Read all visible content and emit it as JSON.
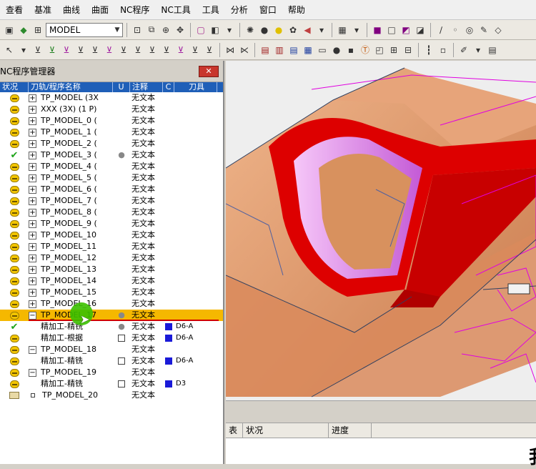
{
  "menu": [
    "查看",
    "基准",
    "曲线",
    "曲面",
    "NC程序",
    "NC工具",
    "工具",
    "分析",
    "窗口",
    "帮助"
  ],
  "toolbar": {
    "model_combo": "MODEL"
  },
  "panel": {
    "title": "NC程序管理器",
    "close_label": "✕",
    "columns": [
      "状况",
      "刀轨/程序名称",
      "U",
      "注释",
      "C",
      "刀具"
    ],
    "rows": [
      {
        "state": "yellow",
        "expand": "+",
        "name": "TP_MODEL (3X",
        "bulb": false,
        "u": false,
        "note": "无文本",
        "c": false,
        "tool": ""
      },
      {
        "state": "yellow",
        "expand": "+",
        "name": "XXX (3X) (1 P)",
        "bulb": false,
        "u": false,
        "note": "无文本",
        "c": false,
        "tool": ""
      },
      {
        "state": "yellow",
        "expand": "+",
        "name": "TP_MODEL_0 (",
        "bulb": false,
        "u": false,
        "note": "无文本",
        "c": false,
        "tool": ""
      },
      {
        "state": "yellow",
        "expand": "+",
        "name": "TP_MODEL_1 (",
        "bulb": false,
        "u": false,
        "note": "无文本",
        "c": false,
        "tool": ""
      },
      {
        "state": "yellow",
        "expand": "+",
        "name": "TP_MODEL_2 (",
        "bulb": false,
        "u": false,
        "note": "无文本",
        "c": false,
        "tool": ""
      },
      {
        "state": "check",
        "expand": "+",
        "name": "TP_MODEL_3 (",
        "bulb": true,
        "u": false,
        "note": "无文本",
        "c": false,
        "tool": ""
      },
      {
        "state": "yellow",
        "expand": "+",
        "name": "TP_MODEL_4 (",
        "bulb": false,
        "u": false,
        "note": "无文本",
        "c": false,
        "tool": ""
      },
      {
        "state": "yellow",
        "expand": "+",
        "name": "TP_MODEL_5 (",
        "bulb": false,
        "u": false,
        "note": "无文本",
        "c": false,
        "tool": ""
      },
      {
        "state": "yellow",
        "expand": "+",
        "name": "TP_MODEL_6 (",
        "bulb": false,
        "u": false,
        "note": "无文本",
        "c": false,
        "tool": ""
      },
      {
        "state": "yellow",
        "expand": "+",
        "name": "TP_MODEL_7 (",
        "bulb": false,
        "u": false,
        "note": "无文本",
        "c": false,
        "tool": ""
      },
      {
        "state": "yellow",
        "expand": "+",
        "name": "TP_MODEL_8 (",
        "bulb": false,
        "u": false,
        "note": "无文本",
        "c": false,
        "tool": ""
      },
      {
        "state": "yellow",
        "expand": "+",
        "name": "TP_MODEL_9 (",
        "bulb": false,
        "u": false,
        "note": "无文本",
        "c": false,
        "tool": ""
      },
      {
        "state": "yellow",
        "expand": "+",
        "name": "TP_MODEL_10",
        "bulb": false,
        "u": false,
        "note": "无文本",
        "c": false,
        "tool": ""
      },
      {
        "state": "yellow",
        "expand": "+",
        "name": "TP_MODEL_11",
        "bulb": false,
        "u": false,
        "note": "无文本",
        "c": false,
        "tool": ""
      },
      {
        "state": "yellow",
        "expand": "+",
        "name": "TP_MODEL_12",
        "bulb": false,
        "u": false,
        "note": "无文本",
        "c": false,
        "tool": ""
      },
      {
        "state": "yellow",
        "expand": "+",
        "name": "TP_MODEL_13",
        "bulb": false,
        "u": false,
        "note": "无文本",
        "c": false,
        "tool": ""
      },
      {
        "state": "yellow",
        "expand": "+",
        "name": "TP_MODEL_14",
        "bulb": false,
        "u": false,
        "note": "无文本",
        "c": false,
        "tool": ""
      },
      {
        "state": "yellow",
        "expand": "+",
        "name": "TP_MODEL_15",
        "bulb": false,
        "u": false,
        "note": "无文本",
        "c": false,
        "tool": ""
      },
      {
        "state": "yellow",
        "expand": "+",
        "name": "TP_MODEL_16",
        "bulb": false,
        "u": false,
        "note": "无文本",
        "c": false,
        "tool": ""
      },
      {
        "state": "yellow",
        "expand": "−",
        "name": "TP_MODEL_17",
        "bulb": true,
        "u": false,
        "note": "无文本",
        "c": false,
        "tool": "",
        "selected": true
      },
      {
        "state": "check",
        "expand": "",
        "name": "精加工-精铣",
        "bulb": true,
        "u": true,
        "note": "无文本",
        "c": true,
        "tool": "D6-A"
      },
      {
        "state": "yellow",
        "expand": "",
        "name": "精加工-根据",
        "bulb": false,
        "u": true,
        "note": "无文本",
        "c": true,
        "tool": "D6-A"
      },
      {
        "state": "yellow",
        "expand": "−",
        "name": "TP_MODEL_18",
        "bulb": false,
        "u": false,
        "note": "无文本",
        "c": false,
        "tool": ""
      },
      {
        "state": "yellow",
        "expand": "",
        "name": "精加工-精铣",
        "bulb": false,
        "u": true,
        "note": "无文本",
        "c": true,
        "tool": "D6-A"
      },
      {
        "state": "yellow",
        "expand": "−",
        "name": "TP_MODEL_19",
        "bulb": false,
        "u": false,
        "note": "无文本",
        "c": false,
        "tool": ""
      },
      {
        "state": "yellow",
        "expand": "",
        "name": "精加工-精铣",
        "bulb": false,
        "u": true,
        "note": "无文本",
        "c": true,
        "tool": "D3"
      },
      {
        "state": "folder",
        "expand": "box",
        "name": "TP_MODEL_20",
        "bulb": false,
        "u": false,
        "note": "无文本",
        "c": false,
        "tool": ""
      }
    ]
  },
  "status": {
    "columns": [
      "表",
      "状况",
      "进度"
    ],
    "glyph": "我"
  },
  "colors": {
    "selection": "#f5b800",
    "header": "#1f5fb8",
    "part": "#e2956a",
    "cut": "#e00000",
    "floor": "#cc66ee",
    "toolpath": "#e000e0"
  }
}
